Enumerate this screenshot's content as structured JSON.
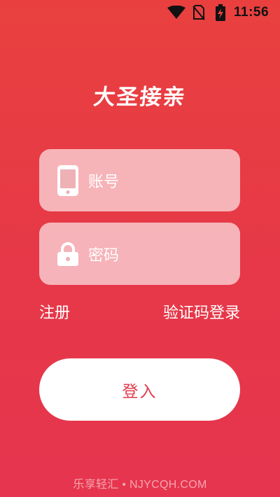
{
  "status_bar": {
    "time": "11:56",
    "icons": [
      "wifi-icon",
      "no-sim-icon",
      "battery-charging-icon"
    ]
  },
  "app": {
    "title": "大圣接亲"
  },
  "form": {
    "account_placeholder": "账号",
    "password_placeholder": "密码",
    "account_icon": "phone-icon",
    "password_icon": "lock-icon"
  },
  "links": {
    "register": "注册",
    "code_login": "验证码登录"
  },
  "login_button": {
    "label": "登入"
  },
  "watermark": {
    "text": "乐享轻汇 • NJYCQH.COM"
  },
  "colors": {
    "background_top": "#e9403f",
    "background_bottom": "#e6354f",
    "button_text": "#e23a4b",
    "status_icons": "#111111"
  }
}
